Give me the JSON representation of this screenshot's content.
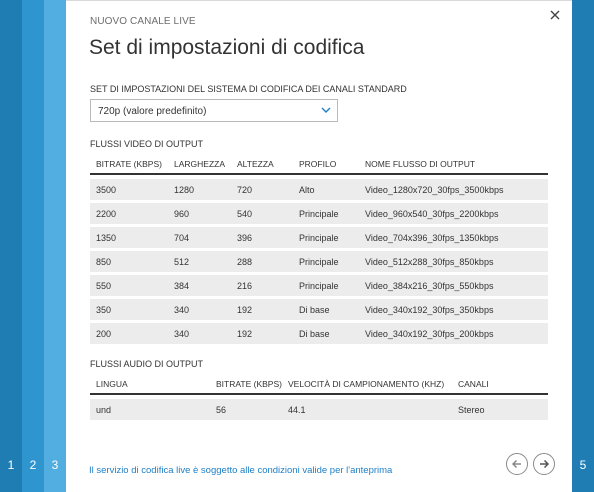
{
  "steps": {
    "s1": "1",
    "s2": "2",
    "s3": "3",
    "s5": "5"
  },
  "dialog": {
    "subtitle": "NUOVO CANALE LIVE",
    "title": "Set di impostazioni di codifica",
    "close_icon": "close-icon",
    "preset_label": "SET DI IMPOSTAZIONI DEL SISTEMA DI CODIFICA DEI CANALI STANDARD",
    "preset_value": "720p (valore predefinito)"
  },
  "video": {
    "section_label": "FLUSSI VIDEO DI OUTPUT",
    "headers": [
      "BITRATE (KBPS)",
      "LARGHEZZA",
      "ALTEZZA",
      "PROFILO",
      "NOME FLUSSO DI OUTPUT"
    ],
    "rows": [
      [
        "3500",
        "1280",
        "720",
        "Alto",
        "Video_1280x720_30fps_3500kbps"
      ],
      [
        "2200",
        "960",
        "540",
        "Principale",
        "Video_960x540_30fps_2200kbps"
      ],
      [
        "1350",
        "704",
        "396",
        "Principale",
        "Video_704x396_30fps_1350kbps"
      ],
      [
        "850",
        "512",
        "288",
        "Principale",
        "Video_512x288_30fps_850kbps"
      ],
      [
        "550",
        "384",
        "216",
        "Principale",
        "Video_384x216_30fps_550kbps"
      ],
      [
        "350",
        "340",
        "192",
        "Di base",
        "Video_340x192_30fps_350kbps"
      ],
      [
        "200",
        "340",
        "192",
        "Di base",
        "Video_340x192_30fps_200kbps"
      ]
    ]
  },
  "audio": {
    "section_label": "FLUSSI AUDIO DI OUTPUT",
    "headers": [
      "LINGUA",
      "BITRATE (KBPS)",
      "VELOCITÀ DI CAMPIONAMENTO (KHZ)",
      "CANALI"
    ],
    "rows": [
      [
        "und",
        "56",
        "44.1",
        "Stereo"
      ]
    ]
  },
  "footer": {
    "link": "Il servizio di codifica live è soggetto alle condizioni valide per l'anteprima",
    "back_icon": "arrow-left-icon",
    "next_icon": "arrow-right-icon"
  },
  "colors": {
    "accent": "#1e8bc3",
    "link": "#1e7fc6",
    "row_bg": "#ececec"
  }
}
